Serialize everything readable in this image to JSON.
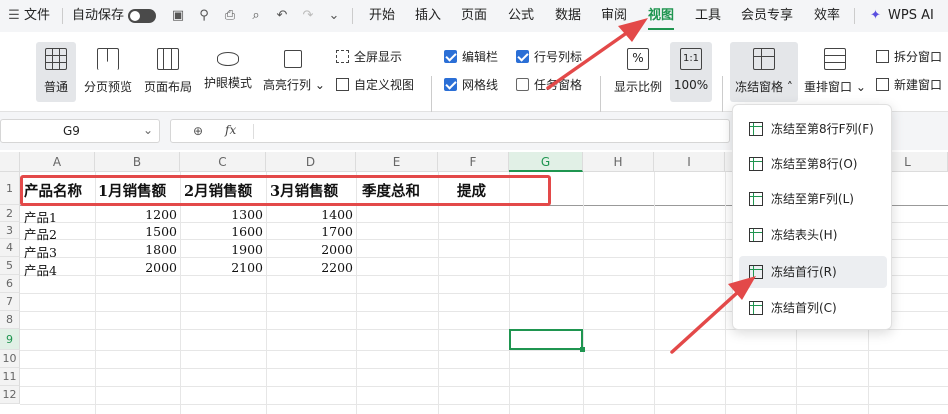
{
  "menu": {
    "file": "文件",
    "autosave": "自动保存",
    "tabs": [
      "开始",
      "插入",
      "页面",
      "公式",
      "数据",
      "审阅",
      "视图",
      "工具",
      "会员专享",
      "效率"
    ],
    "active_tab": "视图",
    "wps_ai": "WPS AI"
  },
  "ribbon": {
    "normal": "普通",
    "page_preview": "分页预览",
    "page_layout": "页面布局",
    "eye_mode": "护眼模式",
    "highlight_rowcol": "高亮行列",
    "fullscreen": "全屏显示",
    "custom_view": "自定义视图",
    "formula_bar": "编辑栏",
    "headings": "行号列标",
    "gridlines": "网格线",
    "task_pane": "任务窗格",
    "zoom": "显示比例",
    "zoom_100": "100%",
    "freeze": "冻结窗格",
    "rearrange": "重排窗口",
    "split": "拆分窗口",
    "new_window": "新建窗口",
    "checkbox_states": {
      "formula_bar": true,
      "headings": true,
      "gridlines": true,
      "task_pane": false
    }
  },
  "formula_bar": {
    "cell_ref": "G9",
    "fx": "fx",
    "value": ""
  },
  "columns": [
    "A",
    "B",
    "C",
    "D",
    "E",
    "F",
    "G",
    "H",
    "I",
    "J",
    "K",
    "L"
  ],
  "rows": [
    "1",
    "2",
    "3",
    "4",
    "5",
    "6",
    "7",
    "8",
    "9",
    "10",
    "11",
    "12"
  ],
  "sheet": {
    "headers": [
      "产品名称",
      "1月销售额",
      "2月销售额",
      "3月销售额",
      "季度总和",
      "提成"
    ],
    "data": [
      [
        "产品1",
        "1200",
        "1300",
        "1400"
      ],
      [
        "产品2",
        "1500",
        "1600",
        "1700"
      ],
      [
        "产品3",
        "1800",
        "1900",
        "2000"
      ],
      [
        "产品4",
        "2000",
        "2100",
        "2200"
      ]
    ]
  },
  "freeze_menu": [
    "冻结至第8行F列(F)",
    "冻结至第8行(O)",
    "冻结至第F列(L)",
    "冻结表头(H)",
    "冻结首行(R)",
    "冻结首列(C)"
  ],
  "colors": {
    "accent": "#1f9550",
    "highlight": "#e34949",
    "checkbox": "#2b6fd6"
  }
}
